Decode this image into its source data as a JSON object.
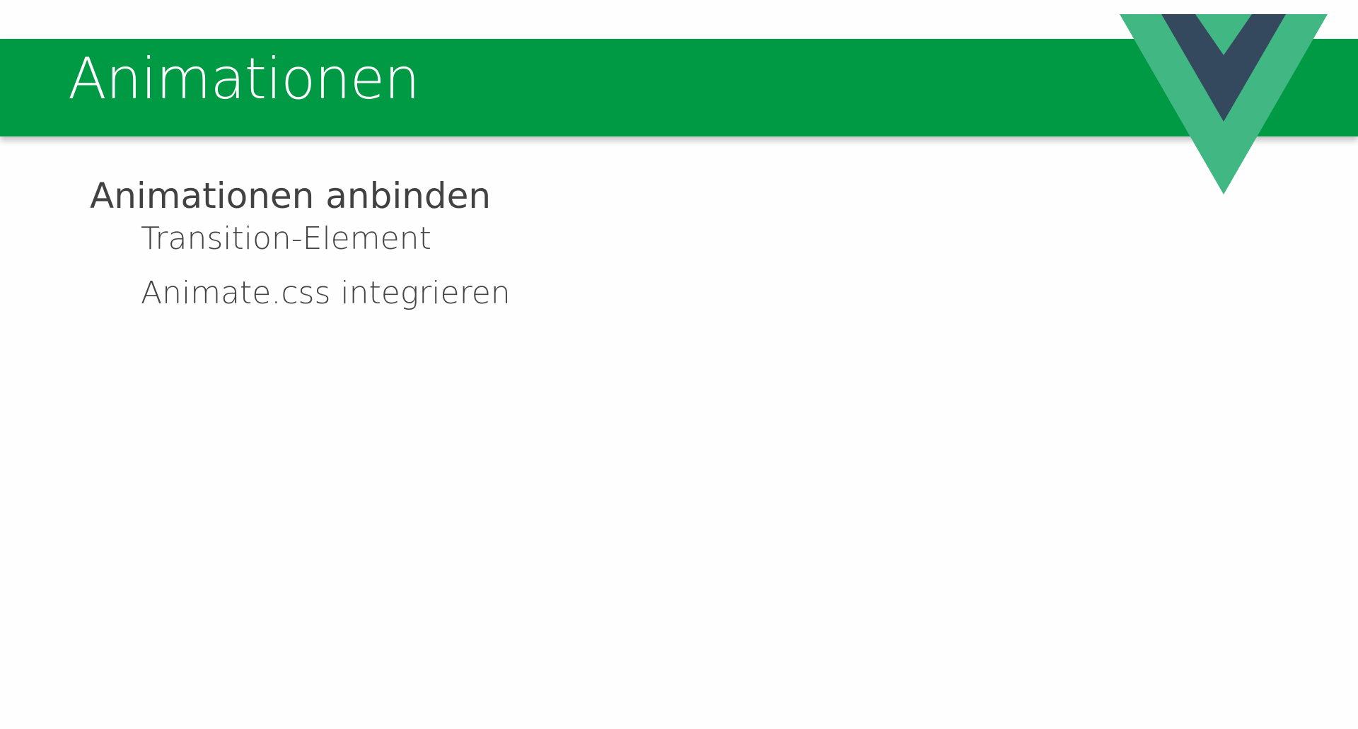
{
  "slide": {
    "title": "Animationen",
    "heading": "Animationen anbinden",
    "items": [
      "Transition-Element",
      "Animate.css integrieren"
    ]
  },
  "logo": {
    "icon": "vue-logo-icon",
    "outer_color": "#41b883",
    "inner_color": "#34495e"
  },
  "colors": {
    "title_bar": "#009a44",
    "title_text": "#ffffff",
    "body_text": "#424242",
    "background": "#fefefe"
  }
}
